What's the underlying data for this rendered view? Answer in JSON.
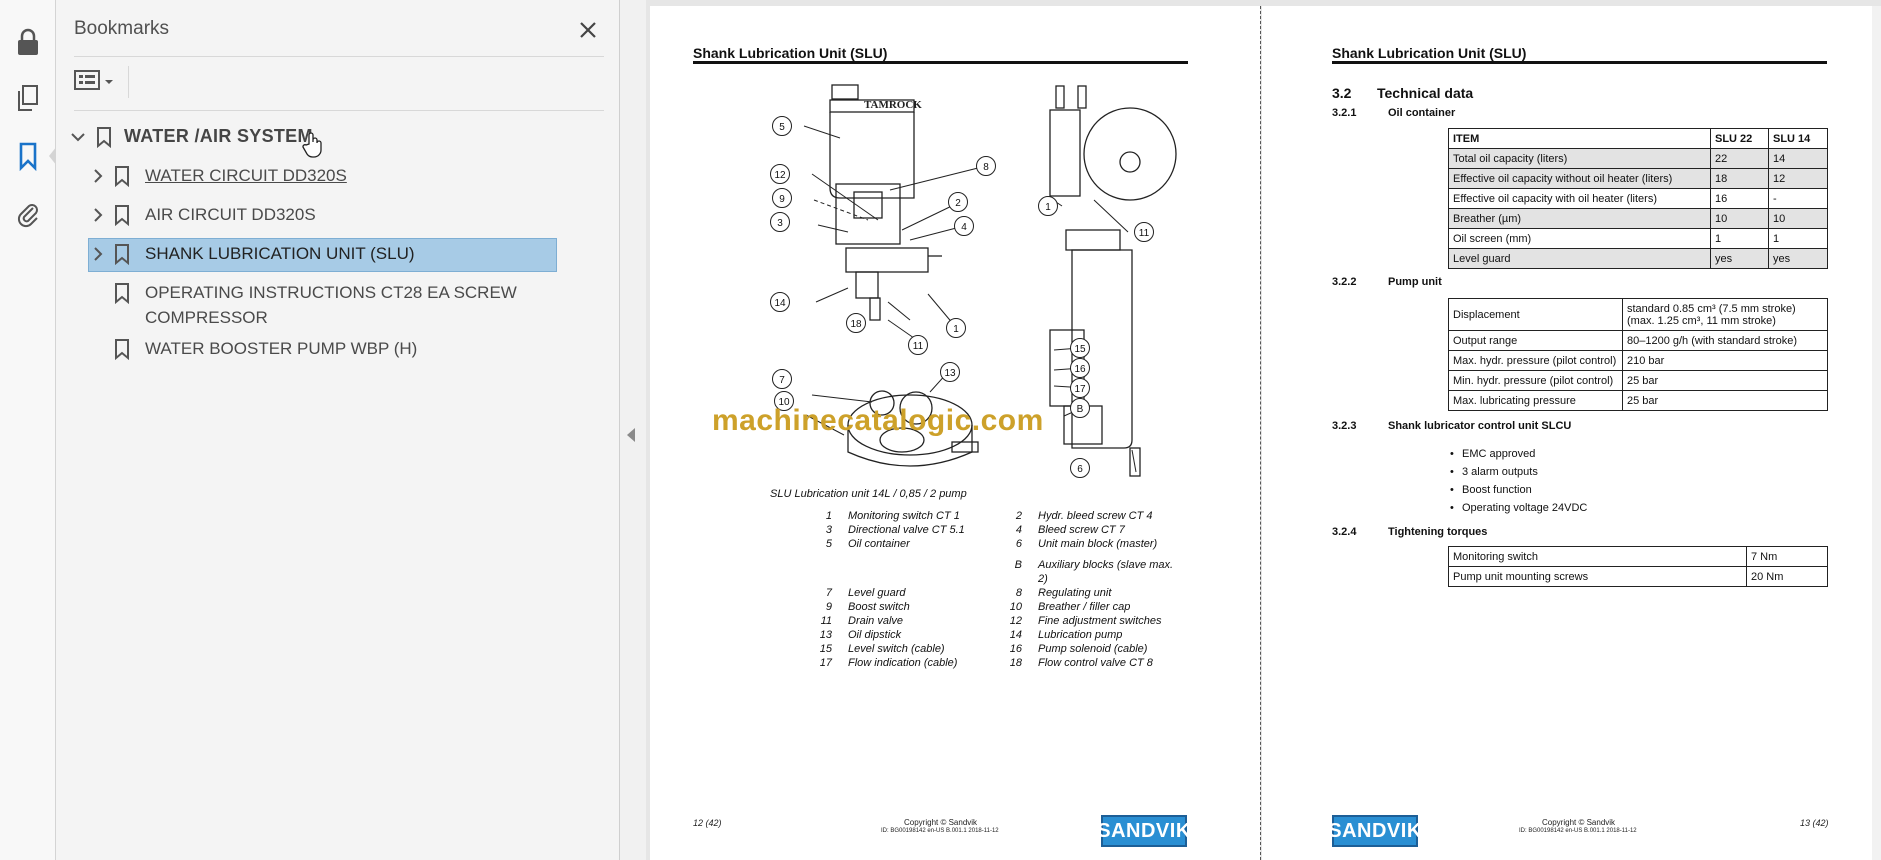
{
  "rail": {
    "icons": [
      "lock-icon",
      "pages-icon",
      "bookmark-icon",
      "attachment-icon"
    ]
  },
  "bookmarks": {
    "title": "Bookmarks",
    "items": [
      {
        "label": "WATER /AIR SYSTEM",
        "expanded": true
      },
      {
        "label": "WATER CIRCUIT DD320S",
        "expanded": false
      },
      {
        "label": "AIR CIRCUIT DD320S",
        "expanded": false
      },
      {
        "label": "SHANK LUBRICATION UNIT (SLU)",
        "expanded": false,
        "selected": true
      },
      {
        "label_line1": "OPERATING INSTRUCTIONS CT28 EA SCREW",
        "label_line2": "COMPRESSOR"
      },
      {
        "label": "WATER BOOSTER PUMP WBP (H)"
      }
    ]
  },
  "page_left": {
    "header": "Shank Lubrication Unit (SLU)",
    "caption": "SLU Lubrication unit 14L / 0,85 / 2 pump",
    "figure_brand": "TAMROCK",
    "callouts": [
      "5",
      "8",
      "12",
      "9",
      "2",
      "3",
      "4",
      "14",
      "18",
      "1",
      "11",
      "7",
      "13",
      "10",
      "1",
      "11",
      "15",
      "16",
      "17",
      "B",
      "6"
    ],
    "legend": [
      {
        "n": "1",
        "t": "Monitoring switch CT 1",
        "n2": "2",
        "t2": "Hydr. bleed screw CT 4"
      },
      {
        "n": "3",
        "t": "Directional valve CT 5.1",
        "n2": "4",
        "t2": "Bleed screw CT 7"
      },
      {
        "n": "5",
        "t": "Oil container",
        "n2": "6",
        "t2": "Unit main block (master)"
      },
      {
        "n": "",
        "t": "",
        "n2": "B",
        "t2": "Auxiliary blocks (slave max.",
        "t2b": "2)"
      },
      {
        "n": "7",
        "t": "Level guard",
        "n2": "8",
        "t2": "Regulating unit"
      },
      {
        "n": "9",
        "t": "Boost switch",
        "n2": "10",
        "t2": "Breather / filler cap"
      },
      {
        "n": "11",
        "t": "Drain valve",
        "n2": "12",
        "t2": "Fine adjustment switches"
      },
      {
        "n": "13",
        "t": "Oil dipstick",
        "n2": "14",
        "t2": "Lubrication pump"
      },
      {
        "n": "15",
        "t": "Level switch (cable)",
        "n2": "16",
        "t2": "Pump solenoid (cable)"
      },
      {
        "n": "17",
        "t": "Flow indication (cable)",
        "n2": "18",
        "t2": "Flow control valve CT 8"
      }
    ],
    "page_no": "12 (42)",
    "copyright": "Copyright © Sandvik",
    "doc_id": "ID: BG00198142 en-US B.001.1 2018-11-12",
    "logo": "SANDVIK"
  },
  "watermark": "machinecatalogic.com",
  "page_right": {
    "header": "Shank Lubrication Unit (SLU)",
    "sec_num": "3.2",
    "sec_title": "Technical data",
    "oil": {
      "num": "3.2.1",
      "title": "Oil container",
      "head": [
        "ITEM",
        "SLU 22",
        "SLU 14"
      ],
      "rows": [
        [
          "Total oil capacity (liters)",
          "22",
          "14"
        ],
        [
          "Effective oil capacity without oil heater (liters)",
          "18",
          "12"
        ],
        [
          "Effective oil capacity with oil heater (liters)",
          "16",
          "-"
        ],
        [
          "Breather (µm)",
          "10",
          "10"
        ],
        [
          "Oil screen (mm)",
          "1",
          "1"
        ],
        [
          "Level guard",
          "yes",
          "yes"
        ]
      ]
    },
    "pump": {
      "num": "3.2.2",
      "title": "Pump unit",
      "rows": [
        [
          "Displacement",
          "standard 0.85 cm³ (7.5 mm stroke)",
          "(max. 1.25 cm³, 11 mm stroke)"
        ],
        [
          "Output range",
          "80–1200 g/h (with standard stroke)",
          ""
        ],
        [
          "Max. hydr. pressure (pilot control)",
          "210 bar",
          ""
        ],
        [
          "Min. hydr. pressure (pilot control)",
          "25 bar",
          ""
        ],
        [
          "Max. lubricating pressure",
          "25 bar",
          ""
        ]
      ]
    },
    "slcu": {
      "num": "3.2.3",
      "title": "Shank lubricator control unit SLCU",
      "bullets": [
        "EMC approved",
        "3 alarm outputs",
        "Boost function",
        "Operating voltage 24VDC"
      ]
    },
    "torque": {
      "num": "3.2.4",
      "title": "Tightening torques",
      "rows": [
        [
          "Monitoring switch",
          "7 Nm"
        ],
        [
          "Pump unit mounting screws",
          "20 Nm"
        ]
      ]
    },
    "page_no": "13 (42)",
    "copyright": "Copyright © Sandvik",
    "doc_id": "ID: BG00198142 en-US B.001.1 2018-11-12",
    "logo": "SANDVIK"
  }
}
